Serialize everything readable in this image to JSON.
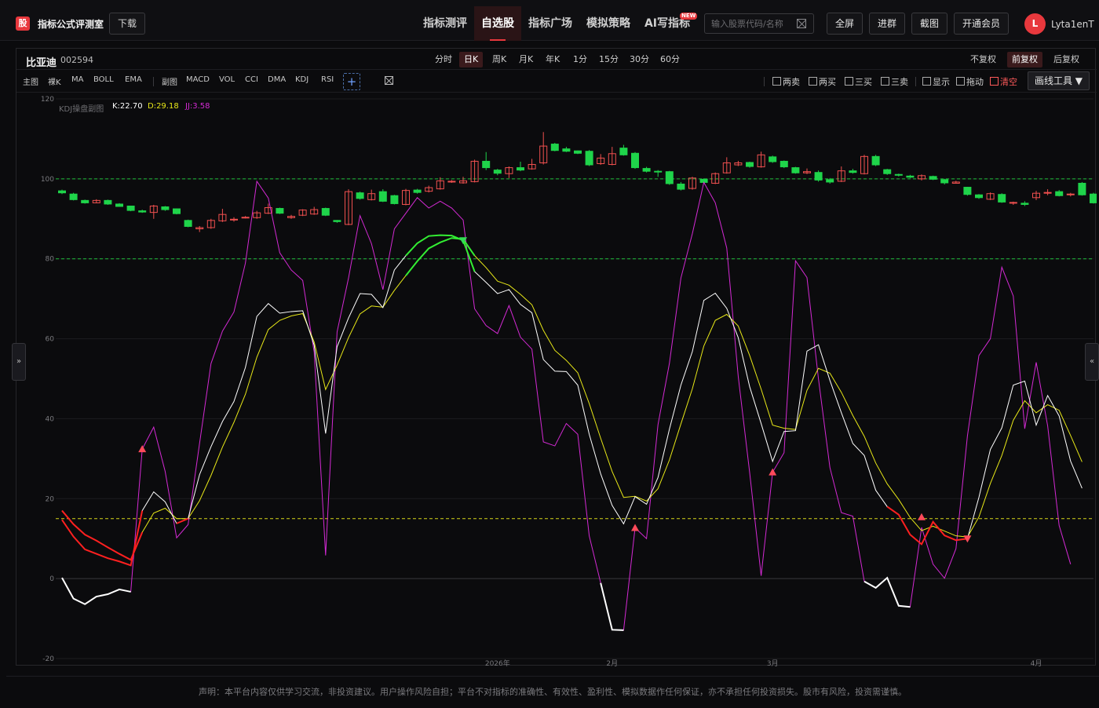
{
  "header": {
    "logo_text": "股",
    "title": "指标公式评测室",
    "download": "下载",
    "nav": [
      "指标测评",
      "自选股",
      "指标广场",
      "模拟策略",
      "AI写指标"
    ],
    "active_nav": 1,
    "new_badge": "NEW",
    "search_placeholder": "输入股票代码/名称",
    "buttons": [
      "全屏",
      "进群",
      "截图",
      "开通会员"
    ],
    "avatar_letter": "L",
    "username": "Lyta1enT"
  },
  "stock": {
    "name": "比亚迪",
    "code": "002594"
  },
  "periods": [
    "分时",
    "日K",
    "周K",
    "月K",
    "年K",
    "1分",
    "15分",
    "30分",
    "60分"
  ],
  "active_period": 1,
  "adjust": [
    "不复权",
    "前复权",
    "后复权"
  ],
  "active_adjust": 1,
  "main_indicators": [
    "主图",
    "裸K",
    "MA",
    "BOLL",
    "EMA"
  ],
  "sub_indicators": [
    "副图",
    "MACD",
    "VOL",
    "CCI",
    "DMA",
    "KDJ",
    "RSI"
  ],
  "plus_label": "+",
  "signal_tools": [
    "两卖",
    "两买",
    "三买",
    "三卖",
    "显示",
    "拖动",
    "清空"
  ],
  "draw_tool": "画线工具 ▼",
  "left_handle": "»",
  "right_handle": "«",
  "legend": {
    "name": "KDJ操盘副图",
    "k": "K:22.70",
    "d": "D:29.18",
    "j": "JJ:3.58"
  },
  "colors": {
    "up": "#f0504f",
    "down": "#1fd44a",
    "k": "#ffffff",
    "d": "#e8e818",
    "j": "#d42ad4",
    "accent": "#e8383d"
  },
  "chart_data": {
    "type": "line",
    "y_ticks": [
      120,
      100,
      80,
      60,
      40,
      20,
      0,
      -20
    ],
    "ylim": [
      -20,
      120
    ],
    "x_labels": [
      "2026年",
      "2月",
      "3月",
      "4月"
    ],
    "x_label_index": [
      38,
      48,
      62,
      85
    ],
    "ref_lines": [
      {
        "y": 100,
        "color": "#1fbf3a"
      },
      {
        "y": 80,
        "color": "#1fbf3a"
      },
      {
        "y": 15,
        "color": "#d8d81a"
      }
    ],
    "candles_price_scale_note": "",
    "candles": [
      [
        97,
        96.5,
        97.3,
        96.2
      ],
      [
        96.2,
        94.8,
        96.5,
        94.6
      ],
      [
        94.6,
        94,
        94.8,
        93.8
      ],
      [
        94,
        94.6,
        94.9,
        93.9
      ],
      [
        94.6,
        93.7,
        94.8,
        93.5
      ],
      [
        93.7,
        93.1,
        93.9,
        93
      ],
      [
        93.2,
        92.1,
        93.3,
        91.9
      ],
      [
        92,
        91.7,
        92.3,
        91.5
      ],
      [
        91.6,
        93.2,
        93.5,
        90
      ],
      [
        93,
        92.3,
        93.2,
        92
      ],
      [
        92.5,
        91.3,
        92.6,
        91.1
      ],
      [
        89.6,
        88.1,
        89.8,
        87.9
      ],
      [
        87.5,
        87.8,
        88.2,
        86.7
      ],
      [
        87.8,
        89.6,
        90,
        87.5
      ],
      [
        89.5,
        91.1,
        92.5,
        89.2
      ],
      [
        89.7,
        89.9,
        90.4,
        89.3
      ],
      [
        90.2,
        90.4,
        90.7,
        90.1
      ],
      [
        90.3,
        91.5,
        92,
        90
      ],
      [
        91.4,
        92.8,
        93.8,
        91.2
      ],
      [
        92.6,
        91.4,
        92.8,
        91.2
      ],
      [
        90.3,
        90.6,
        91,
        90
      ],
      [
        90.9,
        92.2,
        92.4,
        90.7
      ],
      [
        91.2,
        92.3,
        93,
        91
      ],
      [
        92.6,
        90.9,
        92.8,
        90.7
      ],
      [
        89.6,
        89.3,
        89.7,
        89
      ],
      [
        88.6,
        96.8,
        97.4,
        88.4
      ],
      [
        96.5,
        95.1,
        96.8,
        94.8
      ],
      [
        94.8,
        96.3,
        97.3,
        94.6
      ],
      [
        96.8,
        94.4,
        97.4,
        94.2
      ],
      [
        95.8,
        93.8,
        96,
        93.6
      ],
      [
        93.6,
        97.1,
        97.5,
        93.4
      ],
      [
        97.2,
        96.6,
        97.5,
        96.3
      ],
      [
        96.9,
        97.8,
        98.3,
        96.6
      ],
      [
        97.5,
        99.5,
        100.4,
        97.3
      ],
      [
        99.2,
        99.4,
        99.7,
        99
      ],
      [
        99,
        99.5,
        100.5,
        98.8
      ],
      [
        99.3,
        104.4,
        104.8,
        99.1
      ],
      [
        104.4,
        102.8,
        106.7,
        102.2
      ],
      [
        102.2,
        101.4,
        102.5,
        100.9
      ],
      [
        101.3,
        102.8,
        103.1,
        100.2
      ],
      [
        102.8,
        102.2,
        104.3,
        101.9
      ],
      [
        102.5,
        103.6,
        105,
        102.3
      ],
      [
        104,
        108.2,
        111.7,
        103.6
      ],
      [
        108.7,
        107.1,
        109,
        106.9
      ],
      [
        107.5,
        106.9,
        108,
        106.7
      ],
      [
        107,
        106.4,
        107.1,
        106.2
      ],
      [
        106.9,
        103.5,
        107.2,
        103.2
      ],
      [
        103.8,
        105.2,
        106.2,
        103.5
      ],
      [
        103.6,
        106.3,
        108,
        103.4
      ],
      [
        107.7,
        106,
        108.5,
        105.8
      ],
      [
        106.4,
        102.8,
        106.7,
        102.5
      ],
      [
        102.6,
        101.9,
        103,
        101.6
      ],
      [
        101.9,
        101.8,
        102.2,
        100.5
      ],
      [
        101.8,
        98.8,
        102,
        98.5
      ],
      [
        98.7,
        97.4,
        99.2,
        97.1
      ],
      [
        97.6,
        100.2,
        100.5,
        97.3
      ],
      [
        99.9,
        99.1,
        100.1,
        98.8
      ],
      [
        98.9,
        101.3,
        101.6,
        98.7
      ],
      [
        101.5,
        104,
        105.4,
        101.3
      ],
      [
        103.5,
        104,
        104.5,
        103.2
      ],
      [
        104.1,
        103.1,
        104.3,
        102.8
      ],
      [
        103,
        106,
        106.8,
        102.8
      ],
      [
        105.5,
        104.3,
        105.8,
        104
      ],
      [
        104.4,
        103,
        104.6,
        102.7
      ],
      [
        102.8,
        101.5,
        103,
        101.3
      ],
      [
        101.5,
        101.8,
        102.6,
        101.2
      ],
      [
        101.6,
        99.7,
        102.1,
        99.3
      ],
      [
        99.8,
        99.2,
        100.2,
        98.8
      ],
      [
        99.4,
        102,
        103.1,
        99.2
      ],
      [
        102,
        101.6,
        102.5,
        101.3
      ],
      [
        101.3,
        105.6,
        106,
        101.1
      ],
      [
        105.6,
        103.5,
        106,
        103.2
      ],
      [
        102.3,
        101.3,
        102.5,
        101
      ],
      [
        101.1,
        100.9,
        101.3,
        100.6
      ],
      [
        100.7,
        100.4,
        101,
        100.2
      ],
      [
        100,
        100.8,
        101.1,
        99.6
      ],
      [
        100.6,
        99.9,
        100.8,
        99.7
      ],
      [
        99.8,
        99,
        100,
        98.6
      ],
      [
        98.9,
        99.2,
        99.5,
        98.9
      ],
      [
        97.9,
        96.1,
        98,
        95.8
      ],
      [
        96,
        95.3,
        96.2,
        95
      ],
      [
        94.9,
        96.3,
        96.6,
        94.7
      ],
      [
        96.1,
        94.2,
        96.4,
        94
      ],
      [
        94,
        94.1,
        94.3,
        93.5
      ],
      [
        93.9,
        93.6,
        94.4,
        93.2
      ],
      [
        95.3,
        96.4,
        97,
        94.7
      ],
      [
        96.4,
        96.6,
        97.4,
        95.9
      ],
      [
        96.8,
        95.8,
        97.2,
        95.6
      ],
      [
        96.2,
        96.2,
        96.5,
        95.6
      ],
      [
        98.9,
        96,
        99.2,
        95.8
      ],
      [
        96.2,
        94,
        96.5,
        93.8
      ],
      [
        96,
        97,
        97.3,
        95.7
      ],
      [
        96.6,
        95.3,
        96.9,
        95
      ],
      [
        94,
        93.7,
        94.2,
        93.4
      ],
      [
        93.8,
        93,
        94.5,
        92.8
      ]
    ],
    "k": [
      14.7,
      10.5,
      7.3,
      6.2,
      5.1,
      4.3,
      3.3,
      17,
      21.7,
      19.2,
      13.8,
      15,
      26,
      33,
      39.3,
      44.3,
      52.8,
      65.6,
      68.8,
      66.4,
      66.8,
      67,
      58.4,
      36.3,
      58,
      65.2,
      71.3,
      71.1,
      67.8,
      77.2,
      80.8,
      83.9,
      85.7,
      85.9,
      85.8,
      84.6,
      76.8,
      74.1,
      71.3,
      72.3,
      68.6,
      66.5,
      54.8,
      51.9,
      51.8,
      48.4,
      36.1,
      26.2,
      18.3,
      13.7,
      20.5,
      18.6,
      25.3,
      37.4,
      48.4,
      56.8,
      69.6,
      71.4,
      67.6,
      60.3,
      48,
      38.8,
      29.3,
      36.8,
      37,
      56.9,
      58.5,
      49.6,
      41.5,
      33.8,
      30.8,
      22.1,
      18,
      16,
      11,
      8.6,
      14.2,
      10.8,
      9.6,
      10,
      20.3,
      32.3,
      37.7,
      48.4,
      49.4,
      38.4,
      45.8,
      40.7,
      29.4,
      22.6
    ],
    "d": [
      17,
      13.6,
      11,
      9.5,
      7.8,
      6.2,
      4.7,
      11.6,
      16.4,
      17.6,
      15,
      15,
      19.5,
      25.8,
      32.9,
      39.1,
      46.1,
      55.4,
      62.3,
      64.6,
      65.7,
      66.3,
      59.2,
      47.3,
      53.4,
      60.3,
      66.2,
      68.2,
      67.9,
      72.1,
      75.8,
      79.4,
      82.6,
      84.1,
      85.2,
      84.9,
      80.8,
      77.8,
      74.4,
      73.4,
      71.1,
      68.5,
      62.1,
      57.1,
      54.6,
      51.5,
      43.8,
      35.1,
      26.8,
      20.3,
      20.6,
      19.4,
      22.5,
      29.7,
      38.7,
      47.5,
      58.2,
      64.6,
      66.1,
      63.2,
      55.8,
      47.4,
      38.4,
      37.6,
      37.3,
      47.1,
      52.6,
      51.4,
      46.6,
      40.8,
      35.6,
      28.9,
      23.7,
      19.8,
      15.3,
      12,
      13.1,
      11.9,
      10.7,
      10.4,
      15.4,
      23.8,
      30.8,
      39.6,
      44.5,
      41.5,
      43.5,
      42.1,
      35.8,
      29.2
    ],
    "j": [
      0.2,
      -5,
      -6.4,
      -4.5,
      -3.9,
      -2.7,
      -3.3,
      32.4,
      37.9,
      26.8,
      10.2,
      13.5,
      33.8,
      53.8,
      61.9,
      66.7,
      78.9,
      99.4,
      95.2,
      81.5,
      77.2,
      74.6,
      56.7,
      5.8,
      61.7,
      75.2,
      90.8,
      83.8,
      72.3,
      87.5,
      91.4,
      95.3,
      92.7,
      94.4,
      92.7,
      89.7,
      67.5,
      63.3,
      61.3,
      68.3,
      60.4,
      57.4,
      34.2,
      33.2,
      38.8,
      36.1,
      10.7,
      -1.1,
      -12.8,
      -12.9,
      12.7,
      10,
      38.5,
      53.9,
      75.2,
      86.3,
      99.1,
      94,
      82.7,
      50.6,
      26.5,
      0.7,
      26.6,
      31.5,
      79.5,
      75.3,
      50,
      27.8,
      16.5,
      15.6,
      -0.7,
      -2.3,
      0.2,
      -6.8,
      -7.1,
      12.8,
      3.6,
      0.1,
      7.5,
      35.7,
      55.8,
      60,
      77.9,
      70.7,
      37.5,
      54.1,
      38.2,
      13.3,
      3.6
    ],
    "buy_markers": [
      {
        "i": 7,
        "y": 32.4
      },
      {
        "i": 50,
        "y": 12.7
      },
      {
        "i": 62,
        "y": 26.6
      },
      {
        "i": 75,
        "y": 15.4
      }
    ],
    "sell_markers": [
      {
        "i": 35,
        "y": 84.6
      },
      {
        "i": 79,
        "y": 10
      }
    ]
  },
  "footer": "声明：本平台内容仅供学习交流，非投资建议。用户操作风险自担；平台不对指标的准确性、有效性、盈利性、模拟数据作任何保证，亦不承担任何投资损失。股市有风险，投资需谨慎。"
}
